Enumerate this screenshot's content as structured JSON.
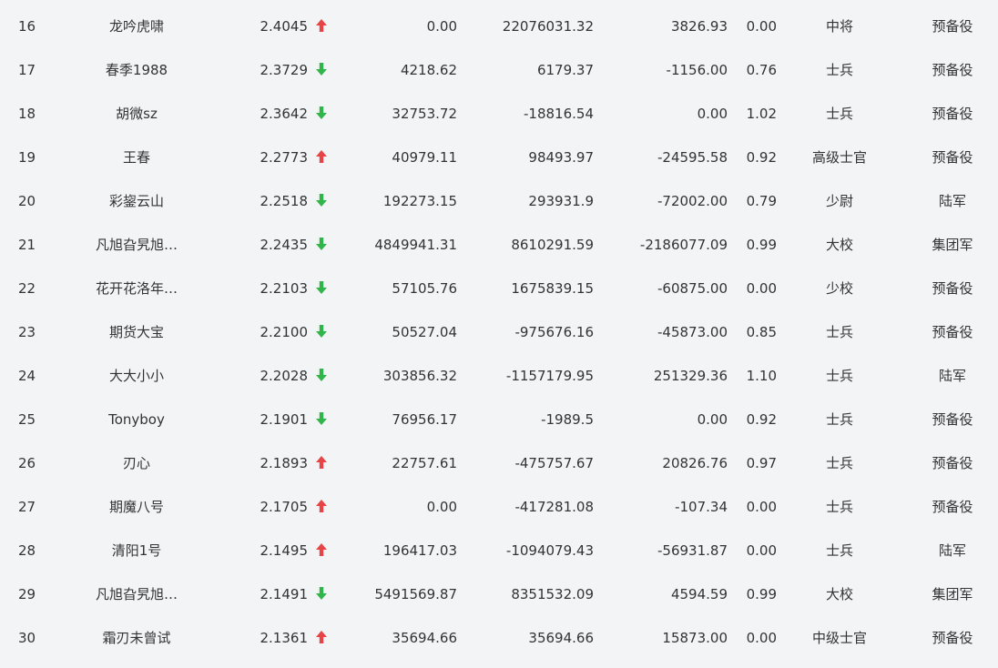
{
  "colors": {
    "up": "#e64545",
    "down": "#31b54a"
  },
  "rows": [
    {
      "rank": "16",
      "name": "龙吟虎啸",
      "score": "2.4045",
      "trend": "up",
      "v1": "0.00",
      "v2": "22076031.32",
      "v3": "3826.93",
      "ratio": "0.00",
      "title": "中将",
      "unit": "预备役"
    },
    {
      "rank": "17",
      "name": "春季1988",
      "score": "2.3729",
      "trend": "down",
      "v1": "4218.62",
      "v2": "6179.37",
      "v3": "-1156.00",
      "ratio": "0.76",
      "title": "士兵",
      "unit": "预备役"
    },
    {
      "rank": "18",
      "name": "胡微sz",
      "score": "2.3642",
      "trend": "down",
      "v1": "32753.72",
      "v2": "-18816.54",
      "v3": "0.00",
      "ratio": "1.02",
      "title": "士兵",
      "unit": "预备役"
    },
    {
      "rank": "19",
      "name": "王春",
      "score": "2.2773",
      "trend": "up",
      "v1": "40979.11",
      "v2": "98493.97",
      "v3": "-24595.58",
      "ratio": "0.92",
      "title": "高级士官",
      "unit": "预备役"
    },
    {
      "rank": "20",
      "name": "彩鋆云山",
      "score": "2.2518",
      "trend": "down",
      "v1": "192273.15",
      "v2": "293931.9",
      "v3": "-72002.00",
      "ratio": "0.79",
      "title": "少尉",
      "unit": "陆军"
    },
    {
      "rank": "21",
      "name": "凡旭旮旯旭…",
      "score": "2.2435",
      "trend": "down",
      "v1": "4849941.31",
      "v2": "8610291.59",
      "v3": "-2186077.09",
      "ratio": "0.99",
      "title": "大校",
      "unit": "集团军"
    },
    {
      "rank": "22",
      "name": "花开花洛年…",
      "score": "2.2103",
      "trend": "down",
      "v1": "57105.76",
      "v2": "1675839.15",
      "v3": "-60875.00",
      "ratio": "0.00",
      "title": "少校",
      "unit": "预备役"
    },
    {
      "rank": "23",
      "name": "期货大宝",
      "score": "2.2100",
      "trend": "down",
      "v1": "50527.04",
      "v2": "-975676.16",
      "v3": "-45873.00",
      "ratio": "0.85",
      "title": "士兵",
      "unit": "预备役"
    },
    {
      "rank": "24",
      "name": "大大小小",
      "score": "2.2028",
      "trend": "down",
      "v1": "303856.32",
      "v2": "-1157179.95",
      "v3": "251329.36",
      "ratio": "1.10",
      "title": "士兵",
      "unit": "陆军"
    },
    {
      "rank": "25",
      "name": "Tonyboy",
      "score": "2.1901",
      "trend": "down",
      "v1": "76956.17",
      "v2": "-1989.5",
      "v3": "0.00",
      "ratio": "0.92",
      "title": "士兵",
      "unit": "预备役"
    },
    {
      "rank": "26",
      "name": "刃心",
      "score": "2.1893",
      "trend": "up",
      "v1": "22757.61",
      "v2": "-475757.67",
      "v3": "20826.76",
      "ratio": "0.97",
      "title": "士兵",
      "unit": "预备役"
    },
    {
      "rank": "27",
      "name": "期魔八号",
      "score": "2.1705",
      "trend": "up",
      "v1": "0.00",
      "v2": "-417281.08",
      "v3": "-107.34",
      "ratio": "0.00",
      "title": "士兵",
      "unit": "预备役"
    },
    {
      "rank": "28",
      "name": "清阳1号",
      "score": "2.1495",
      "trend": "up",
      "v1": "196417.03",
      "v2": "-1094079.43",
      "v3": "-56931.87",
      "ratio": "0.00",
      "title": "士兵",
      "unit": "陆军"
    },
    {
      "rank": "29",
      "name": "凡旭旮旯旭…",
      "score": "2.1491",
      "trend": "down",
      "v1": "5491569.87",
      "v2": "8351532.09",
      "v3": "4594.59",
      "ratio": "0.99",
      "title": "大校",
      "unit": "集团军"
    },
    {
      "rank": "30",
      "name": "霜刃未曾试",
      "score": "2.1361",
      "trend": "up",
      "v1": "35694.66",
      "v2": "35694.66",
      "v3": "15873.00",
      "ratio": "0.00",
      "title": "中级士官",
      "unit": "预备役"
    }
  ]
}
